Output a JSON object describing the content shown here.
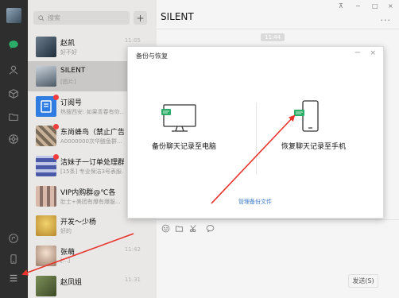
{
  "search": {
    "placeholder": "搜索"
  },
  "add_button": {
    "label": "+"
  },
  "chats": [
    {
      "name": "赵凯",
      "preview": "好不好",
      "time": "11:05",
      "unread": false,
      "selected": false
    },
    {
      "name": "SILENT",
      "preview": "[图片]",
      "time": "",
      "unread": false,
      "selected": true
    },
    {
      "name": "订阅号",
      "preview": "热搜西安: 如果青春有你...",
      "time": "",
      "unread": true,
      "selected": false
    },
    {
      "name": "东尚蜂鸟（禁止广告...",
      "preview": "A0000000次华鲢鱼群...",
      "time": "",
      "unread": true,
      "selected": false
    },
    {
      "name": "洁妹子一订单处理群",
      "preview": "[15条] 专业保洁3号表服...",
      "time": "",
      "unread": true,
      "selected": false
    },
    {
      "name": "VIP内购群@℃各",
      "preview": "肚士+美团有爆有爆服...",
      "time": "",
      "unread": false,
      "selected": false
    },
    {
      "name": "开发～少杨",
      "preview": "好的",
      "time": "",
      "unread": false,
      "selected": false
    },
    {
      "name": "张萌",
      "preview": "[...]",
      "time": "11:42",
      "unread": false,
      "selected": false
    },
    {
      "name": "赵凤姐",
      "preview": "",
      "time": "11:31",
      "unread": false,
      "selected": false
    }
  ],
  "conversation": {
    "title": "SILENT",
    "more_label": "...",
    "timestamp": "11:44",
    "send_label": "发送(S)"
  },
  "window_controls": {
    "pin": "⊼",
    "minimize": "−",
    "maximize": "□",
    "close": "×"
  },
  "dialog": {
    "title": "备份与恢复",
    "minimize": "−",
    "close": "×",
    "backup_label": "备份聊天记录至电脑",
    "restore_label": "恢复聊天记录至手机",
    "manage_label": "管理备份文件"
  },
  "colors": {
    "rail_bg": "#2e2e2e",
    "list_bg": "#e9e8e7",
    "chat_bg": "#f5f5f5",
    "accent_green": "#2bae67",
    "unread_red": "#f03d3d",
    "annotation_arrow": "#e8322a",
    "link_blue": "#3d7ac7"
  },
  "icons": {
    "rail": [
      "chat-icon",
      "contacts-icon",
      "favorites-icon",
      "folder-icon",
      "moments-icon",
      "miniprogram-icon",
      "phone-icon",
      "menu-icon"
    ],
    "toolbar": [
      "emoji-icon",
      "file-icon",
      "screenshot-icon",
      "chat-history-icon"
    ]
  }
}
